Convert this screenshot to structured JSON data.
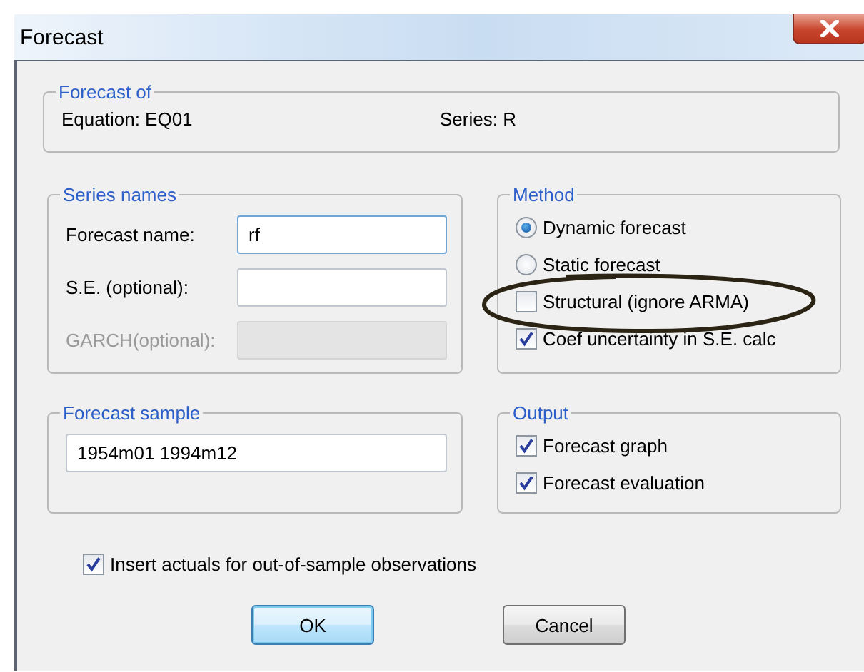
{
  "window": {
    "title": "Forecast"
  },
  "forecast_of": {
    "title": "Forecast of",
    "equation": "Equation: EQ01",
    "series": "Series: R"
  },
  "series_names": {
    "title": "Series names",
    "fields": [
      {
        "label": "Forecast name:",
        "value": "rf",
        "disabled": false,
        "focused": true
      },
      {
        "label": "S.E. (optional):",
        "disabled": false,
        "focused": false
      },
      {
        "label": "GARCH(optional):",
        "disabled": true,
        "focused": false
      }
    ]
  },
  "method": {
    "title": "Method",
    "options": [
      {
        "kind": "radio",
        "label": "Dynamic forecast",
        "selected": true
      },
      {
        "kind": "radio",
        "label": "Static forecast",
        "selected": false
      },
      {
        "kind": "checkbox",
        "label": "Structural (ignore ARMA)",
        "checked": false
      },
      {
        "kind": "checkbox",
        "label": "Coef uncertainty in S.E. calc",
        "checked": true
      }
    ]
  },
  "forecast_sample": {
    "title": "Forecast sample",
    "value": "1954m01 1994m12"
  },
  "output": {
    "title": "Output",
    "options": [
      {
        "kind": "checkbox",
        "label": "Forecast graph",
        "checked": true
      },
      {
        "kind": "checkbox",
        "label": "Forecast evaluation",
        "checked": true
      }
    ]
  },
  "insert_actuals": {
    "label": "Insert actuals for out-of-sample observations",
    "checked": true
  },
  "buttons": [
    {
      "label": "OK",
      "default": true
    },
    {
      "label": "Cancel",
      "default": false
    }
  ]
}
